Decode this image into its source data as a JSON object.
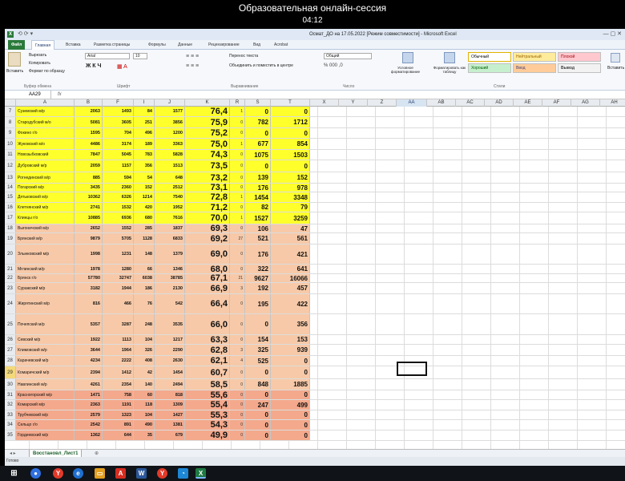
{
  "session": {
    "title": "Образовательная онлайн-сессия",
    "clock": "04:12"
  },
  "window": {
    "title": "Осмат_ДО на 17.05.2022 [Режим совместимости] - Microsoft Excel"
  },
  "ribbon": {
    "tabs": [
      "Файл",
      "Главная",
      "Вставка",
      "Разметка страницы",
      "Формулы",
      "Данные",
      "Рецензирование",
      "Вид",
      "Acrobat"
    ],
    "clipboard": {
      "paste": "Вставить",
      "cut": "Вырезать",
      "copy": "Копировать",
      "format": "Формат по образцу",
      "label": "Буфер обмена"
    },
    "font": {
      "name": "Arial",
      "size": "10",
      "label": "Шрифт"
    },
    "alignment": {
      "wrap": "Перенос текста",
      "merge": "Объединить и поместить в центре",
      "label": "Выравнивание"
    },
    "number": {
      "format": "Общий",
      "label": "Число"
    },
    "styles": {
      "cond": "Условное форматирование",
      "table": "Форматировать как таблицу",
      "normal": "Обычный",
      "neutral": "Нейтральный",
      "bad": "Плохой",
      "good": "Хороший",
      "input": "Ввод",
      "output": "Вывод",
      "label": "Стили"
    },
    "insert": "Вставить"
  },
  "formula_bar": {
    "name_box": "AA29",
    "fx": "fx"
  },
  "columns": [
    "A",
    "B",
    "F",
    "I",
    "J",
    "K",
    "R",
    "S",
    "T",
    "X",
    "Y",
    "Z",
    "AA",
    "AB",
    "AC",
    "AD",
    "AE",
    "AF",
    "AG",
    "AH"
  ],
  "colors": {
    "yellow": "#ffff2c",
    "orange": "#f7c9a8",
    "red": "#f4a98c",
    "excel_green": "#2a7a3a"
  },
  "rows": [
    {
      "n": "7",
      "name": "Суземский м/р",
      "b": "2063",
      "f": "1493",
      "i": "84",
      "j": "1577",
      "k": "76,4",
      "r": "1",
      "s": "0",
      "t": "0",
      "fill": "yellow"
    },
    {
      "n": "8",
      "name": "Стародубский м/о",
      "b": "5081",
      "f": "3605",
      "i": "251",
      "j": "3856",
      "k": "75,9",
      "r": "0",
      "s": "782",
      "t": "1712",
      "fill": "yellow"
    },
    {
      "n": "9",
      "name": "Фокино г/о",
      "b": "1595",
      "f": "704",
      "i": "496",
      "j": "1200",
      "k": "75,2",
      "r": "0",
      "s": "0",
      "t": "0",
      "fill": "yellow"
    },
    {
      "n": "10",
      "name": "Жуковский м/о",
      "b": "4486",
      "f": "3174",
      "i": "189",
      "j": "3363",
      "k": "75,0",
      "r": "1",
      "s": "677",
      "t": "854",
      "fill": "yellow"
    },
    {
      "n": "11",
      "name": "Новозыбковский",
      "b": "7847",
      "f": "5045",
      "i": "783",
      "j": "5828",
      "k": "74,3",
      "r": "0",
      "s": "1075",
      "t": "1503",
      "fill": "yellow"
    },
    {
      "n": "12",
      "name": "Дубровский м/р",
      "b": "2059",
      "f": "1157",
      "i": "356",
      "j": "1513",
      "k": "73,5",
      "r": "0",
      "s": "0",
      "t": "0",
      "fill": "yellow"
    },
    {
      "n": "13",
      "name": "Рогнединский м/р",
      "b": "885",
      "f": "594",
      "i": "54",
      "j": "648",
      "k": "73,2",
      "r": "0",
      "s": "139",
      "t": "152",
      "fill": "yellow"
    },
    {
      "n": "14",
      "name": "Погарский м/р",
      "b": "3435",
      "f": "2360",
      "i": "152",
      "j": "2512",
      "k": "73,1",
      "r": "0",
      "s": "176",
      "t": "978",
      "fill": "yellow"
    },
    {
      "n": "15",
      "name": "Дятьковский м/р",
      "b": "10362",
      "f": "6326",
      "i": "1214",
      "j": "7540",
      "k": "72,8",
      "r": "1",
      "s": "1454",
      "t": "3348",
      "fill": "yellow"
    },
    {
      "n": "16",
      "name": "Клетнянский м/р",
      "b": "2741",
      "f": "1532",
      "i": "420",
      "j": "1952",
      "k": "71,2",
      "r": "0",
      "s": "82",
      "t": "79",
      "fill": "yellow"
    },
    {
      "n": "17",
      "name": "Клинцы г/о",
      "b": "10885",
      "f": "6936",
      "i": "680",
      "j": "7616",
      "k": "70,0",
      "r": "1",
      "s": "1527",
      "t": "3259",
      "fill": "yellow"
    },
    {
      "n": "18",
      "name": "Выгоничский м/р",
      "b": "2652",
      "f": "1552",
      "i": "285",
      "j": "1837",
      "k": "69,3",
      "r": "0",
      "s": "106",
      "t": "47",
      "fill": "orange"
    },
    {
      "n": "19",
      "name": "Брянский м/р",
      "b": "9879",
      "f": "5705",
      "i": "1128",
      "j": "6833",
      "k": "69,2",
      "r": "27",
      "s": "521",
      "t": "561",
      "fill": "orange"
    },
    {
      "n": "20",
      "name": "Злынковский м/р",
      "b": "1998",
      "f": "1231",
      "i": "148",
      "j": "1379",
      "k": "69,0",
      "r": "0",
      "s": "176",
      "t": "421",
      "fill": "orange"
    },
    {
      "n": "21",
      "name": "Мглинский м/р",
      "b": "1978",
      "f": "1280",
      "i": "66",
      "j": "1346",
      "k": "68,0",
      "r": "0",
      "s": "322",
      "t": "641",
      "fill": "orange"
    },
    {
      "n": "22",
      "name": "Брянск г/о",
      "b": "57780",
      "f": "32747",
      "i": "6038",
      "j": "38785",
      "k": "67,1",
      "r": "21",
      "s": "9627",
      "t": "16066",
      "fill": "orange"
    },
    {
      "n": "23",
      "name": "Суражский м/р",
      "b": "3182",
      "f": "1944",
      "i": "186",
      "j": "2130",
      "k": "66,9",
      "r": "3",
      "s": "192",
      "t": "457",
      "fill": "orange"
    },
    {
      "n": "24",
      "name": "Жирятинский м/р",
      "b": "816",
      "f": "466",
      "i": "76",
      "j": "542",
      "k": "66,4",
      "r": "0",
      "s": "195",
      "t": "422",
      "fill": "orange"
    },
    {
      "n": "25",
      "name": "Почепский м/р",
      "b": "5357",
      "f": "3287",
      "i": "248",
      "j": "3535",
      "k": "66,0",
      "r": "0",
      "s": "0",
      "t": "356",
      "fill": "orange"
    },
    {
      "n": "26",
      "name": "Севский м/р",
      "b": "1922",
      "f": "1113",
      "i": "104",
      "j": "1217",
      "k": "63,3",
      "r": "0",
      "s": "154",
      "t": "153",
      "fill": "orange"
    },
    {
      "n": "27",
      "name": "Климовский м/р",
      "b": "3644",
      "f": "1964",
      "i": "326",
      "j": "2290",
      "k": "62,8",
      "r": "3",
      "s": "325",
      "t": "939",
      "fill": "orange"
    },
    {
      "n": "28",
      "name": "Карачевский м/р",
      "b": "4234",
      "f": "2222",
      "i": "408",
      "j": "2630",
      "k": "62,1",
      "r": "4",
      "s": "525",
      "t": "0",
      "fill": "orange"
    },
    {
      "n": "29",
      "name": "Комаричский м/р",
      "b": "2394",
      "f": "1412",
      "i": "42",
      "j": "1454",
      "k": "60,7",
      "r": "0",
      "s": "0",
      "t": "0",
      "fill": "orange"
    },
    {
      "n": "30",
      "name": "Навлинский м/р",
      "b": "4261",
      "f": "2354",
      "i": "140",
      "j": "2494",
      "k": "58,5",
      "r": "0",
      "s": "848",
      "t": "1885",
      "fill": "orange"
    },
    {
      "n": "31",
      "name": "Красногорский м/р",
      "b": "1471",
      "f": "758",
      "i": "60",
      "j": "818",
      "k": "55,6",
      "r": "0",
      "s": "0",
      "t": "0",
      "fill": "red"
    },
    {
      "n": "32",
      "name": "Комарский м/р",
      "b": "2363",
      "f": "1191",
      "i": "118",
      "j": "1309",
      "k": "55,4",
      "r": "0",
      "s": "247",
      "t": "499",
      "fill": "red"
    },
    {
      "n": "33",
      "name": "Трубчевский м/р",
      "b": "2579",
      "f": "1323",
      "i": "104",
      "j": "1427",
      "k": "55,3",
      "r": "0",
      "s": "0",
      "t": "0",
      "fill": "red"
    },
    {
      "n": "34",
      "name": "Сельцо г/о",
      "b": "2542",
      "f": "891",
      "i": "490",
      "j": "1381",
      "k": "54,3",
      "r": "0",
      "s": "0",
      "t": "0",
      "fill": "red"
    },
    {
      "n": "35",
      "name": "Гордеевский м/р",
      "b": "1362",
      "f": "644",
      "i": "35",
      "j": "679",
      "k": "49,9",
      "r": "0",
      "s": "0",
      "t": "0",
      "fill": "red"
    }
  ],
  "sheets": [
    "Восстановл_Лист1"
  ],
  "status": "Готово"
}
